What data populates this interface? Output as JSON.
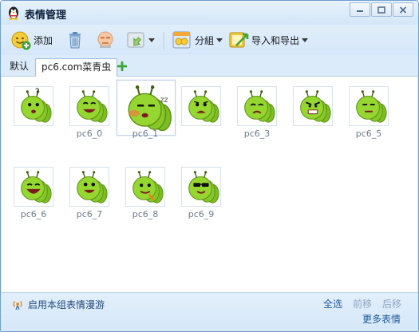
{
  "window": {
    "title": "表情管理"
  },
  "toolbar": {
    "add_label": "添加",
    "group_label": "分組",
    "import_export_label": "导入和导出"
  },
  "tabs": [
    {
      "label": "默认",
      "active": false
    },
    {
      "label": "pc6.com菜青虫",
      "active": true
    }
  ],
  "emoticons": [
    {
      "label": "",
      "expression": "confused",
      "selected": false
    },
    {
      "label": "pc6_0",
      "expression": "happy",
      "selected": false
    },
    {
      "label": "pc6_1",
      "expression": "sleepy",
      "selected": true
    },
    {
      "label": "",
      "expression": "frown",
      "selected": false
    },
    {
      "label": "pc6_3",
      "expression": "sad",
      "selected": false
    },
    {
      "label": "",
      "expression": "angry",
      "selected": false
    },
    {
      "label": "pc6_5",
      "expression": "annoyed",
      "selected": false
    },
    {
      "label": "pc6_6",
      "expression": "laugh",
      "selected": false
    },
    {
      "label": "pc6_7",
      "expression": "grin",
      "selected": false
    },
    {
      "label": "pc6_8",
      "expression": "cool",
      "selected": false
    },
    {
      "label": "pc6_9",
      "expression": "",
      "selected": false
    }
  ],
  "footer": {
    "roam_label": "启用本组表情漫游",
    "select_all": "全选",
    "move_forward": "前移",
    "move_back": "后移",
    "more": "更多表情"
  },
  "colors": {
    "accent": "#1d5a99",
    "caterpillar": "#8dcf2c",
    "window_bg": "#dcebfa"
  }
}
